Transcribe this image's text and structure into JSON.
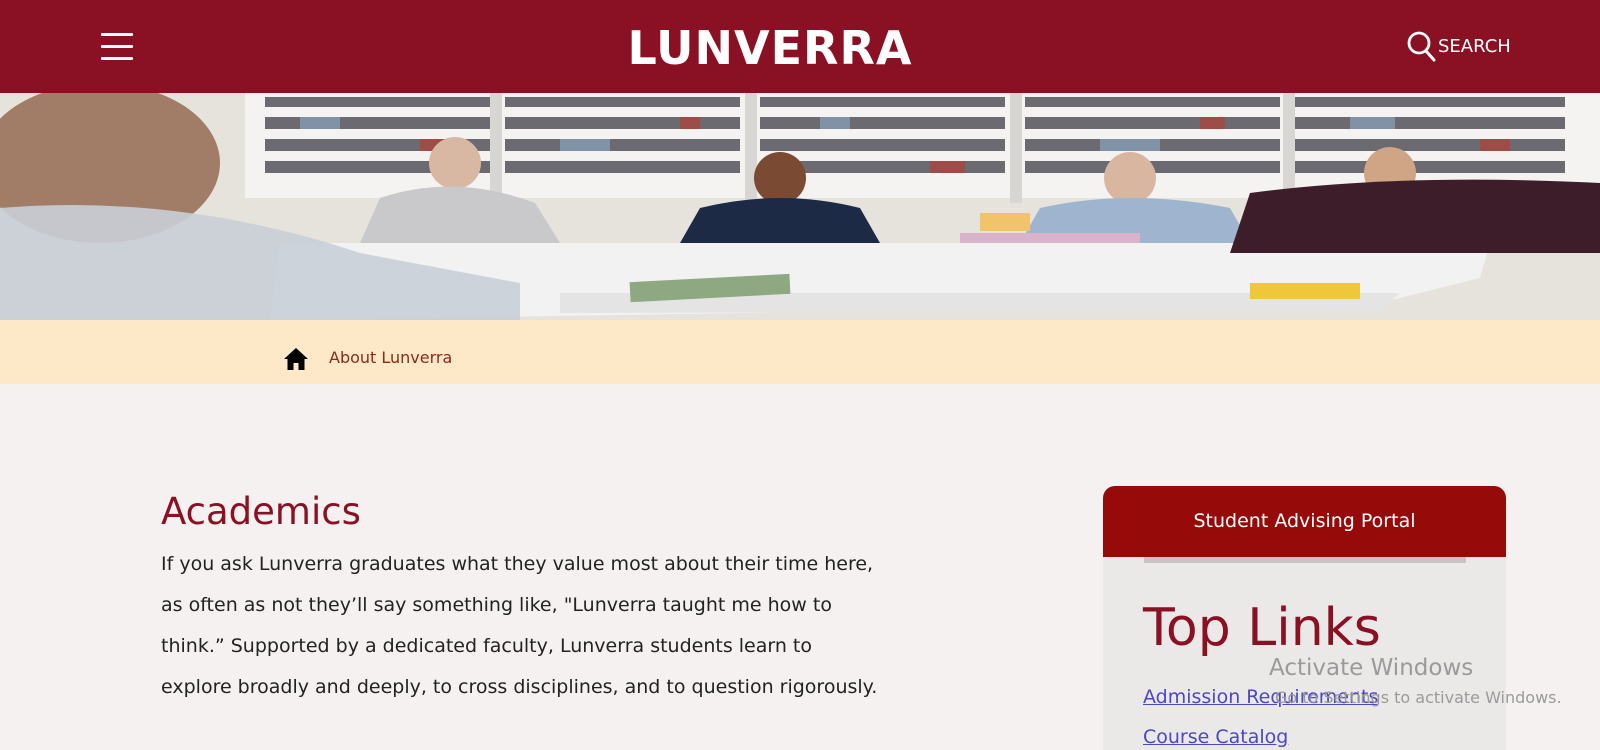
{
  "header": {
    "brand": "LUNVERRA",
    "search_label": "SEARCH",
    "background": "#8a1024"
  },
  "breadcrumb": {
    "items": [
      "About Lunverra"
    ]
  },
  "main": {
    "title": "Academics",
    "body": "If you ask Lunverra graduates what they value most about their time here, as often as not they’ll say something like, \"Lunverra taught me how to think.” Supported by a dedicated faculty, Lunverra students learn to explore broadly and deeply, to cross disciplines, and to question rigorously."
  },
  "sidebar": {
    "portal_button": "Student Advising Portal",
    "links_title": "Top Links",
    "links": [
      "Admission Requirements",
      "Course Catalog"
    ]
  },
  "watermark": {
    "title": "Activate Windows",
    "subtitle": "Go to Settings to activate Windows."
  },
  "colors": {
    "brand": "#8a1024",
    "breadcrumb_bg": "#fde8c8",
    "link": "#4a47c8",
    "portal": "#960a0a"
  }
}
